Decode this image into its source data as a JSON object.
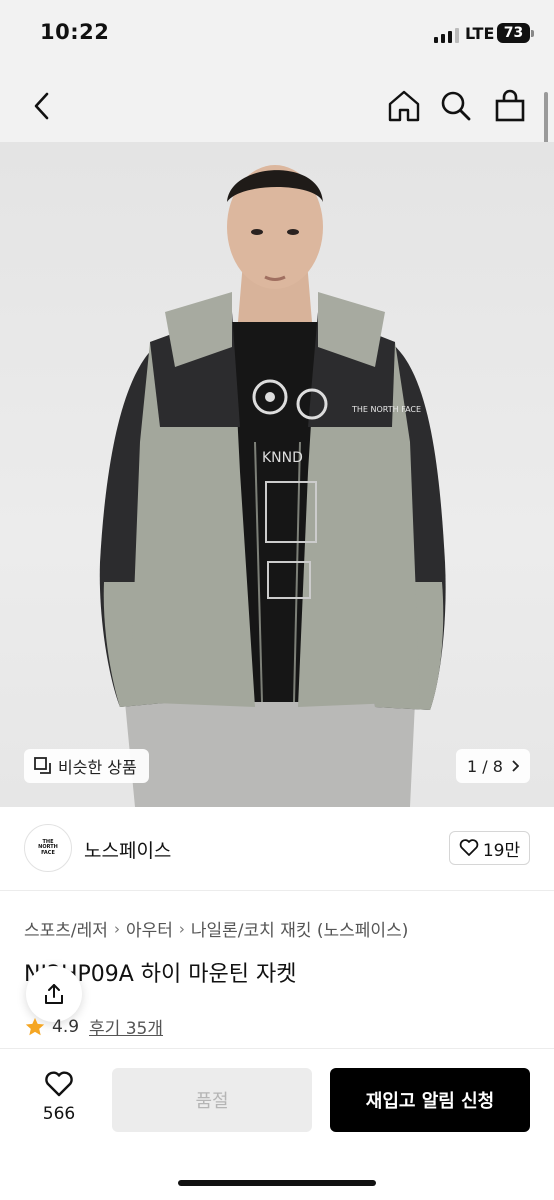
{
  "status_bar": {
    "time": "10:22",
    "network": "LTE",
    "battery": "73"
  },
  "nav": {
    "back_icon": "back-arrow-icon",
    "home_icon": "home-icon",
    "search_icon": "search-icon",
    "cart_icon": "shopping-bag-icon"
  },
  "hero": {
    "similar_label": "비슷한 상품",
    "pager_current": "1",
    "pager_total": "8",
    "pager_text": "1 / 8"
  },
  "brand": {
    "name": "노스페이스",
    "logo_text": "THE NORTH FACE",
    "like_count": "19만"
  },
  "breadcrumb": [
    "스포츠/레저",
    "아우터",
    "나일론/코치 재킷 (노스페이스)"
  ],
  "product": {
    "title": "NJ2HP09A 하이 마운틴 자켓",
    "rating": "4.9",
    "reviews": "후기 35개"
  },
  "bottom": {
    "wish_count": "566",
    "soldout_label": "품절",
    "notify_label": "재입고 알림 신청"
  },
  "colors": {
    "accent": "#000000",
    "star": "#f5a623",
    "soldout_bg": "#ececec",
    "jacket_gray": "#a3a79c",
    "jacket_black": "#2a2a2c"
  }
}
